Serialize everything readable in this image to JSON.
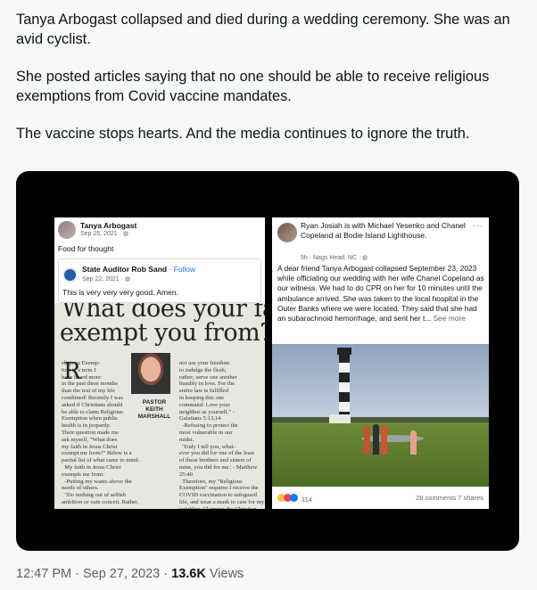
{
  "tweet": {
    "paragraphs": [
      "Tanya Arbogast collapsed and died during a wedding ceremony. She was an avid cyclist.",
      "She posted articles saying that no one should be able to receive religious exemptions from Covid vaccine mandates.",
      "The vaccine stops hearts. And the media continues to ignore the truth."
    ],
    "time": "12:47 PM",
    "date": "Sep 27, 2023",
    "views_count": "13.6K",
    "views_label": "Views"
  },
  "left_post": {
    "author": "Tanya Arbogast",
    "date": "Sep 25, 2021 · ",
    "caption": "Food for thought",
    "shared_author": "State Auditor Rob Sand",
    "follow": " · Follow",
    "shared_date": "Sep 22, 2021 · ",
    "shared_text": "This is very very very good. Amen.",
    "headline_1": "What does your faith",
    "headline_2": "exempt you from?",
    "dropcap": "R",
    "col1": "eligious Exemp-\ntion is a term I\nhave heard more\nin the past three months\nthan the rest of my life\ncombined! Recently I was\nasked if Christians should\nbe able to claim Religious\nExemption when public\nhealth is in jeopardy.\nTheir question made me\nask myself, \"What does\nmy faith in Jesus Christ\nexempt me from?\" Below is a\npartial list of what came to mind.\n  My faith in Jesus Christ\nexempts me from:\n  -Putting my wants above the\nneeds of others.\n  \"Do nothing out of selfish\nambition or vain conceit. Rather,",
    "col3": "not use your freedom\nto indulge the flesh;\nrather, serve one another\nhumbly in love. For the\nentire law is fulfilled\nin keeping this one\ncommand: Love your\nneighbor as yourself.\" -\nGalatians 5:13,14\n  -Refusing to protect the\nmost vulnerable in our\nmidst.\n  'Truly I tell you, what-\never you did for one of the least\nof these brothers and sisters of\nmine, you did for me.' - Matthew\n25:40\n  Therefore, my \"Religious\nExemption\" requires I receive the\nCOVID vaccination to safeguard\nlife, and wear a mask to care for my\nneighbor. Claiming the Christian",
    "byline": "PASTOR\nKEITH\nMARSHALL"
  },
  "right_post": {
    "head": "Ryan Josiah is with Michael Yesenko and Chanel Copeland at Bodie Island Lighthouse.",
    "dots": "···",
    "meta": "5h · Nags Head, NC · ",
    "body": "A dear friend Tanya Arbogast collapsed September 23, 2023 while officiating our wedding with her wife Chanel Copeland as our witness. We had to do CPR on her for 10 minutes until the ambulance arrived. She was taken to the local hospital in the Outer Banks where we were located. They said that she had an subarachnoid hemorrhage, and sent her t...",
    "see_more": " See more",
    "reactions": "114",
    "comments": "28 comments  7 shares"
  }
}
